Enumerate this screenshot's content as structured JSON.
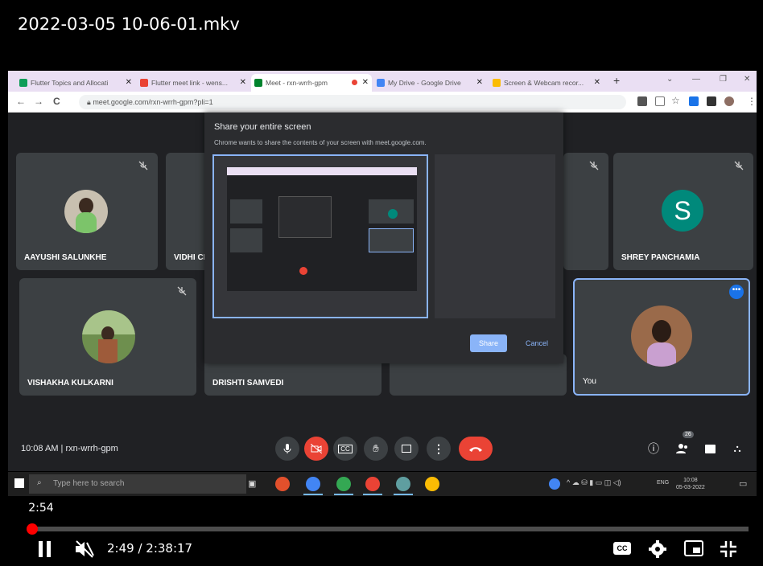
{
  "video": {
    "title": "2022-03-05 10-06-01.mkv",
    "hover_time": "2:54",
    "time_display": "2:49 / 2:38:17",
    "progress_fraction": 0.0018
  },
  "browser": {
    "tabs": [
      {
        "label": "Flutter Topics and Allocati",
        "color": "#0f9d58"
      },
      {
        "label": "Flutter meet link - wens...",
        "color": "#ea4335"
      },
      {
        "label": "Meet - rxn-wrrh-gpm",
        "color": "#00832d",
        "active": true
      },
      {
        "label": "My Drive - Google Drive",
        "color": "#4285f4"
      },
      {
        "label": "Screen & Webcam recor...",
        "color": "#fbbc04"
      }
    ],
    "url": "meet.google.com/rxn-wrrh-gpm?pli=1"
  },
  "meet": {
    "participants": [
      {
        "name": "AAYUSHI SALUNKHE"
      },
      {
        "name": "VIDHI CH"
      },
      {
        "name": "SHREY PANCHAMIA",
        "initial": "S"
      },
      {
        "name": "VISHAKHA KULKARNI"
      },
      {
        "name": "DRISHTI SAMVEDI"
      },
      {
        "name": "You"
      }
    ],
    "meeting_info": "10:08 AM  |  rxn-wrrh-gpm",
    "people_count": "26"
  },
  "share_dialog": {
    "title": "Share your entire screen",
    "description": "Chrome wants to share the contents of your screen with meet.google.com.",
    "share_label": "Share",
    "cancel_label": "Cancel"
  },
  "taskbar": {
    "search_placeholder": "Type here to search",
    "tray_lang": "ENG",
    "clock_time": "10:08",
    "clock_date": "05-03-2022"
  },
  "colors": {
    "meet_bg": "#202124",
    "tile_bg": "#3c4043",
    "accent_blue": "#8ab4f8",
    "end_call_red": "#ea4335",
    "yt_red": "#ff0000"
  }
}
